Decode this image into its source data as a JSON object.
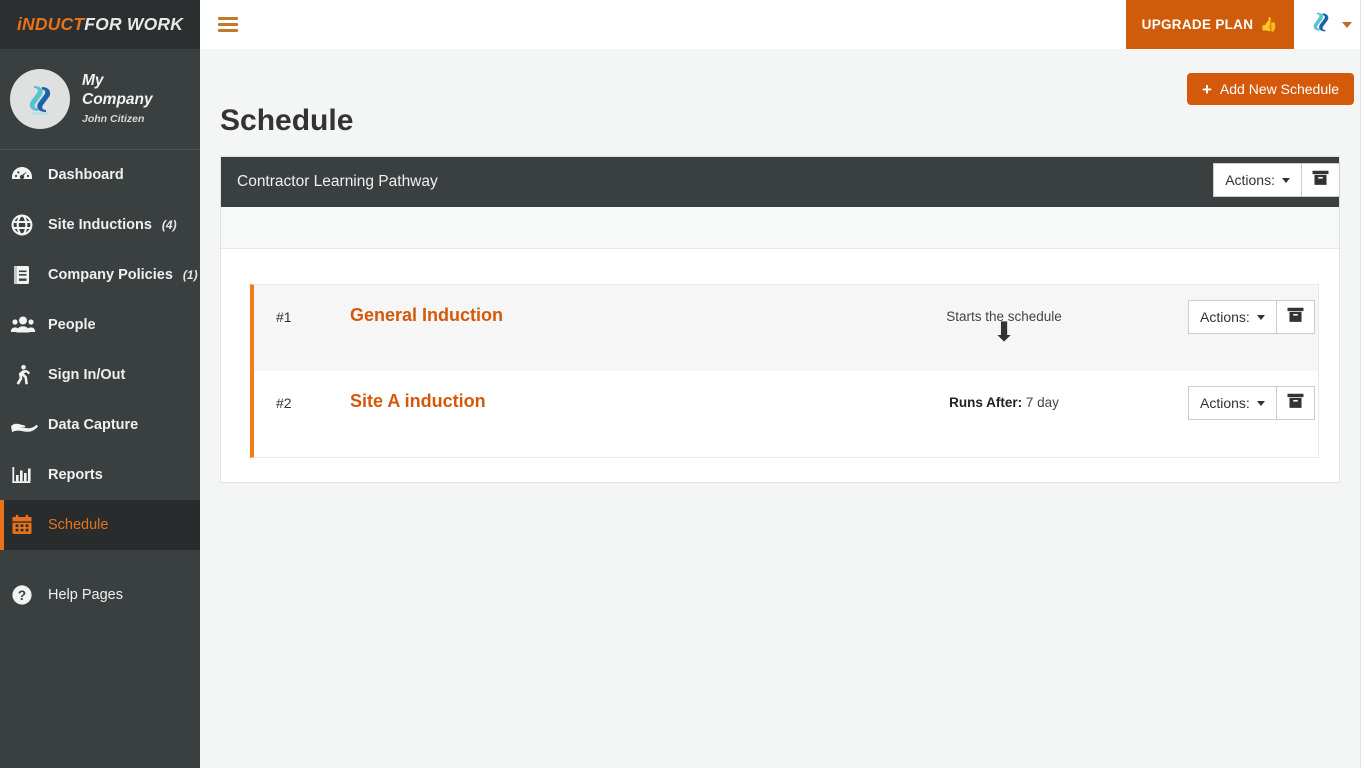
{
  "brand": {
    "part1": "iNDUCT",
    "part2": "FOR WORK"
  },
  "company": {
    "name": "My Company",
    "user": "John Citizen",
    "avatar_icon": "company-logo-icon"
  },
  "sidebar": {
    "items": [
      {
        "label": "Dashboard",
        "icon": "gauge-icon",
        "count": "",
        "active": false
      },
      {
        "label": "Site Inductions",
        "icon": "globe-icon",
        "count": "(4)",
        "active": false
      },
      {
        "label": "Company Policies",
        "icon": "book-icon",
        "count": "(1)",
        "active": false
      },
      {
        "label": "People",
        "icon": "people-icon",
        "count": "",
        "active": false
      },
      {
        "label": "Sign In/Out",
        "icon": "walking-icon",
        "count": "",
        "active": false
      },
      {
        "label": "Data Capture",
        "icon": "hand-icon",
        "count": "",
        "active": false
      },
      {
        "label": "Reports",
        "icon": "bar-chart-icon",
        "count": "",
        "active": false
      },
      {
        "label": "Schedule",
        "icon": "calendar-icon",
        "count": "",
        "active": true
      },
      {
        "label": "Help Pages",
        "icon": "question-icon",
        "count": "",
        "active": false
      }
    ]
  },
  "topbar": {
    "menu_toggle_icon": "hamburger-icon",
    "upgrade_label": "UPGRADE PLAN",
    "upgrade_icon": "thumbs-up-icon",
    "user_avatar_icon": "user-logo-icon",
    "user_caret_icon": "chevron-down-icon"
  },
  "main": {
    "page_title": "Schedule",
    "add_button_label": "Add New Schedule",
    "add_button_icon": "plus-icon"
  },
  "panel": {
    "title": "Contractor Learning Pathway",
    "actions_label": "Actions:",
    "archive_icon": "archive-box-icon",
    "caret_icon": "caret-down-icon"
  },
  "schedule_items": [
    {
      "number": "#1",
      "name": "General Induction",
      "when_label": "",
      "when_value": "Starts the schedule",
      "actions_label": "Actions:",
      "archive_icon": "archive-box-icon",
      "arrow_icon": "arrow-down-icon"
    },
    {
      "number": "#2",
      "name": "Site A induction",
      "when_label": "Runs After:",
      "when_value": "7 day",
      "actions_label": "Actions:",
      "archive_icon": "archive-box-icon",
      "arrow_icon": ""
    }
  ],
  "colors": {
    "brand_orange": "#e8721c",
    "accent_orange": "#d4590a",
    "sidebar_bg": "#3a3f3f",
    "sidebar_active_bg": "#292c2c",
    "panel_header_bg": "#3a3f3f",
    "content_bg": "#f4f5f5"
  }
}
